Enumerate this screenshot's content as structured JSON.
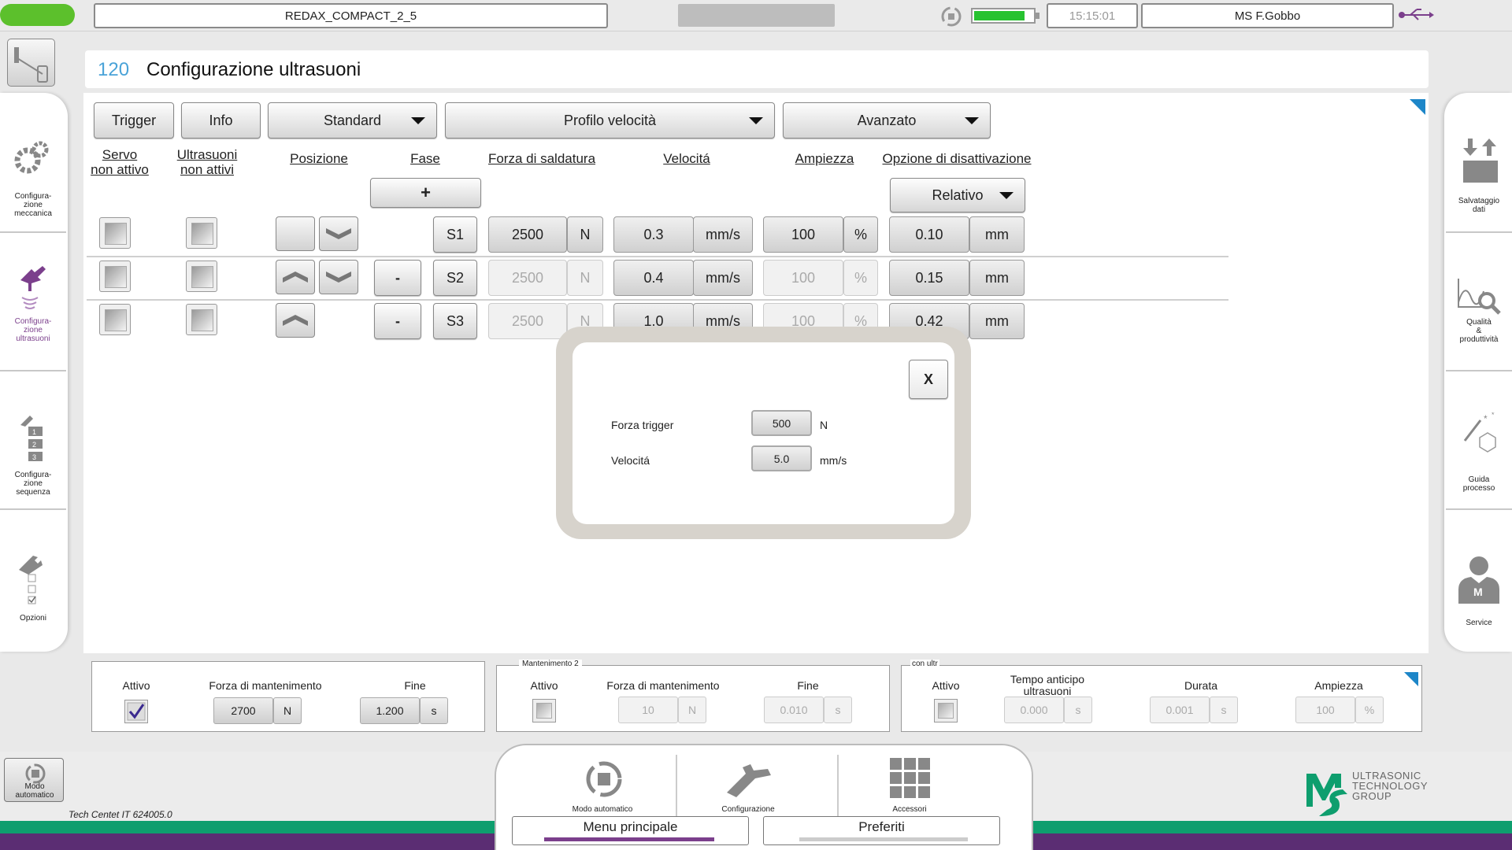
{
  "top_bar": {
    "machine_name": "REDAX_COMPACT_2_5",
    "time": "15:15:01",
    "user": "MS F.Gobbo"
  },
  "page": {
    "number": "120",
    "title": "Configurazione ultrasuoni"
  },
  "toolbar": {
    "trigger": "Trigger",
    "info": "Info",
    "standard": "Standard",
    "profilo": "Profilo velocità",
    "avanzato": "Avanzato"
  },
  "columns": {
    "servo": "Servo\nnon attivo",
    "ultrasuoni": "Ultrasuoni\nnon attivi",
    "posizione": "Posizione",
    "fase": "Fase",
    "forza": "Forza di saldatura",
    "velocita": "Velocitá",
    "ampiezza": "Ampiezza",
    "opzione": "Opzione di disattivazione"
  },
  "add_button": "+",
  "relativo": "Relativo",
  "rows": [
    {
      "phase": "S1",
      "remove": "",
      "force": "2500",
      "force_unit": "N",
      "speed": "0.3",
      "speed_unit": "mm/s",
      "amplitude": "100",
      "amp_unit": "%",
      "deact": "0.10",
      "deact_unit": "mm"
    },
    {
      "phase": "S2",
      "remove": "-",
      "force": "2500",
      "force_unit": "N",
      "speed": "0.4",
      "speed_unit": "mm/s",
      "amplitude": "100",
      "amp_unit": "%",
      "deact": "0.15",
      "deact_unit": "mm"
    },
    {
      "phase": "S3",
      "remove": "-",
      "force": "2500",
      "force_unit": "N",
      "speed": "1.0",
      "speed_unit": "mm/s",
      "amplitude": "100",
      "amp_unit": "%",
      "deact": "0.42",
      "deact_unit": "mm"
    }
  ],
  "dialog": {
    "close": "X",
    "forza_label": "Forza trigger",
    "forza_value": "500",
    "forza_unit": "N",
    "vel_label": "Velocitá",
    "vel_value": "5.0",
    "vel_unit": "mm/s"
  },
  "left_sidebar": [
    {
      "label": "Configura-\nzione\nmeccanica"
    },
    {
      "label": "Configura-\nzione\nultrasuoni"
    },
    {
      "label": "Configura-\nzione\nsequenza"
    },
    {
      "label": "Opzioni"
    }
  ],
  "right_sidebar": [
    {
      "label": "Salvataggio\ndati"
    },
    {
      "label": "Qualità\n&\nproduttività"
    },
    {
      "label": "Guida\nprocesso"
    },
    {
      "label": "Service"
    }
  ],
  "bottom_panel1": {
    "attivo": "Attivo",
    "forza_label": "Forza di mantenimento",
    "forza_value": "2700",
    "forza_unit": "N",
    "fine_label": "Fine",
    "fine_value": "1.200",
    "fine_unit": "s"
  },
  "bottom_panel2": {
    "legend": "Mantenimento 2",
    "attivo": "Attivo",
    "forza_label": "Forza di mantenimento",
    "forza_value": "10",
    "forza_unit": "N",
    "fine_label": "Fine",
    "fine_value": "0.010",
    "fine_unit": "s"
  },
  "bottom_panel3": {
    "legend": "con ultr",
    "attivo": "Attivo",
    "tempo_label": "Tempo anticipo\nultrasuoni",
    "tempo_value": "0.000",
    "tempo_unit": "s",
    "durata_label": "Durata",
    "durata_value": "0.001",
    "durata_unit": "s",
    "amp_label": "Ampiezza",
    "amp_value": "100",
    "amp_unit": "%"
  },
  "footer": {
    "modo_btn": "Modo\nautomatico",
    "tech": "Tech Centet IT 624005.0",
    "nav1": "Modo automatico",
    "nav2": "Configurazione",
    "nav3": "Accessori",
    "menu": "Menu principale",
    "preferiti": "Preferiti",
    "logo_text": "ULTRASONIC\nTECHNOLOGY\nGROUP"
  },
  "colors": {
    "accent_purple": "#7b3f8c",
    "brand_green": "#0e9e6e",
    "status_green": "#5cc02c",
    "page_number_blue": "#4aa3d8"
  }
}
